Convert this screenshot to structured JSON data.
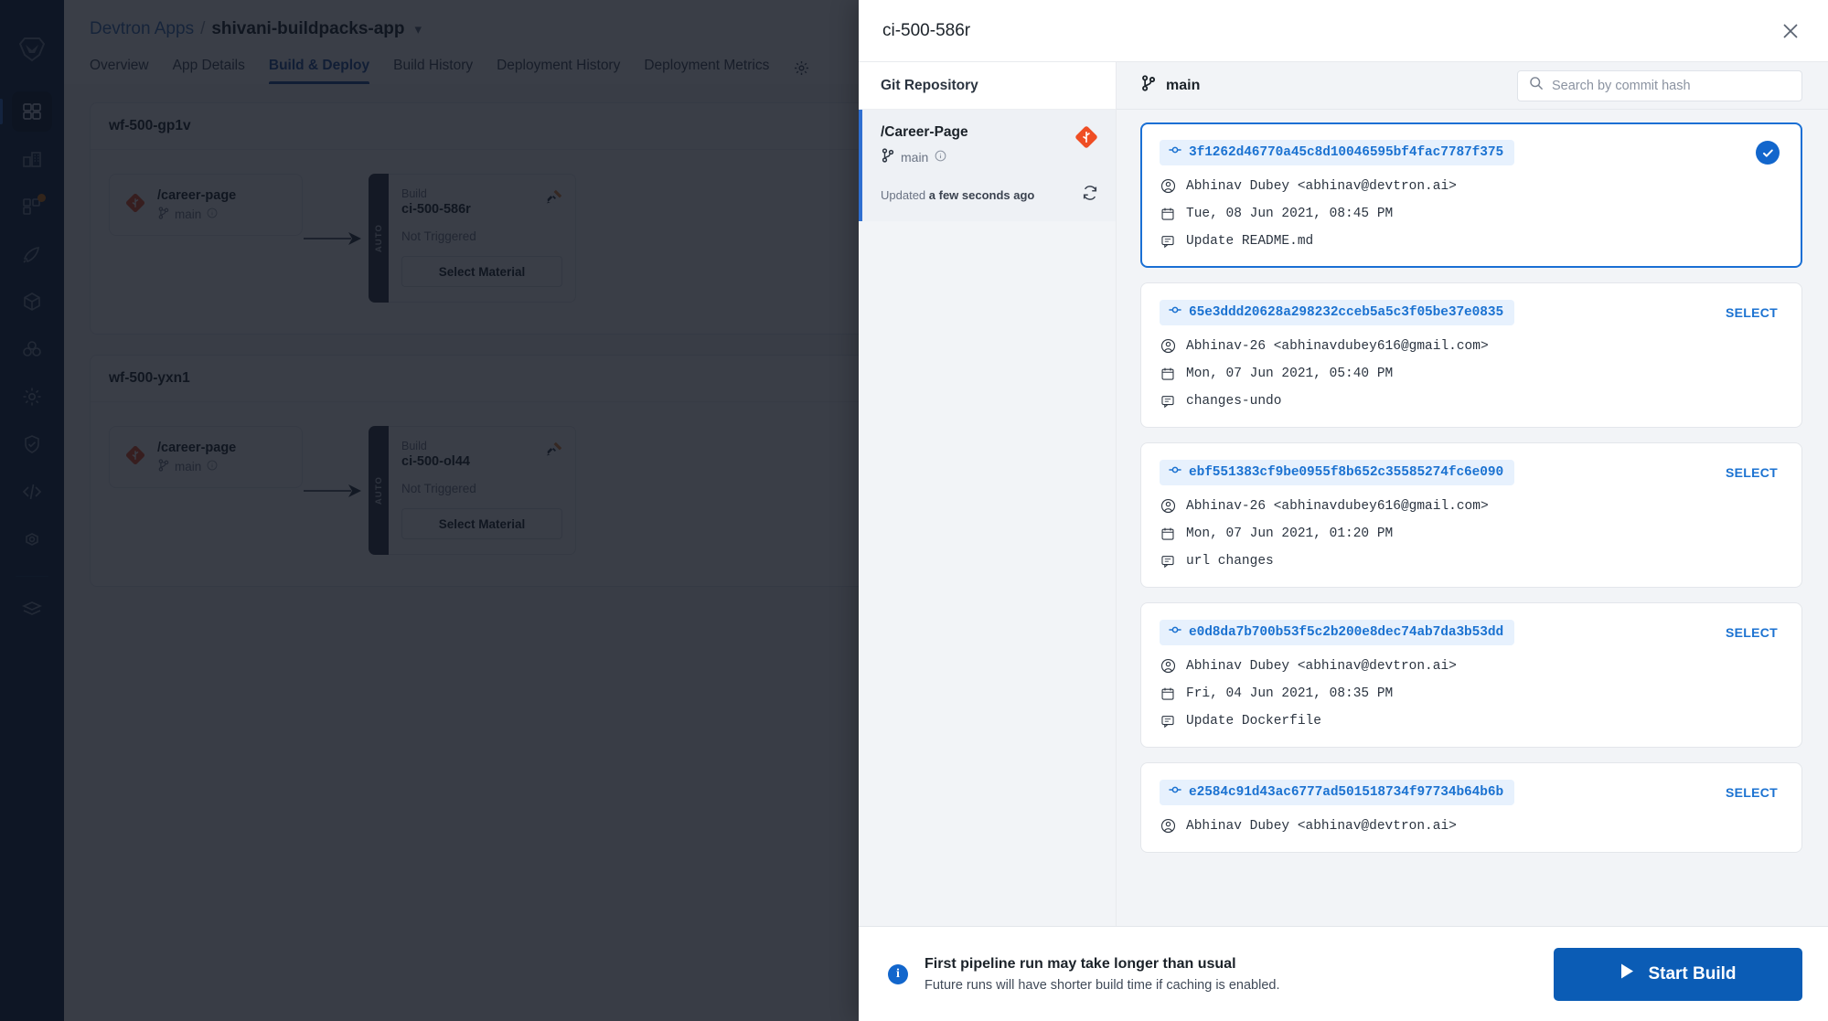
{
  "nav": {
    "logo_icon": "devtron-logo-icon",
    "items": [
      {
        "icon": "applications-icon",
        "active": true,
        "badge": false
      },
      {
        "icon": "chart-store-icon",
        "active": false,
        "badge": false
      },
      {
        "icon": "app-groups-icon",
        "active": false,
        "badge": true
      },
      {
        "icon": "rocket-deploy-icon",
        "active": false,
        "badge": false
      },
      {
        "icon": "cube-resource-icon",
        "active": false,
        "badge": false
      },
      {
        "icon": "clusters-icon",
        "active": false,
        "badge": false
      },
      {
        "icon": "gear-settings-icon",
        "active": false,
        "badge": false
      },
      {
        "icon": "shield-security-icon",
        "active": false,
        "badge": false
      },
      {
        "icon": "code-bracket-icon",
        "active": false,
        "badge": false
      },
      {
        "icon": "cog-global-config-icon",
        "active": false,
        "badge": false
      },
      {
        "icon": "stack-layers-icon",
        "active": false,
        "badge": false
      }
    ]
  },
  "breadcrumb": {
    "root": "Devtron Apps",
    "separator": "/",
    "current": "shivani-buildpacks-app",
    "caret_icon": "chevron-down-icon"
  },
  "tabs": [
    {
      "label": "Overview",
      "active": false
    },
    {
      "label": "App Details",
      "active": false
    },
    {
      "label": "Build & Deploy",
      "active": true
    },
    {
      "label": "Build History",
      "active": false
    },
    {
      "label": "Deployment History",
      "active": false
    },
    {
      "label": "Deployment Metrics",
      "active": false
    }
  ],
  "tabs_gear_icon": "gear-icon",
  "workflows": [
    {
      "name": "wf-500-gp1v",
      "git_node": {
        "repo": "/career-page",
        "branch": "main",
        "icon": "git-diamond-icon",
        "info_icon": "info-icon",
        "branch_icon": "branch-icon"
      },
      "ci_node": {
        "auto_label": "AUTO",
        "label": "Build",
        "name": "ci-500-586r",
        "status": "Not Triggered",
        "button": "Select Material",
        "tools_icon": "build-tools-icon"
      }
    },
    {
      "name": "wf-500-yxn1",
      "git_node": {
        "repo": "/career-page",
        "branch": "main",
        "icon": "git-diamond-icon",
        "info_icon": "info-icon",
        "branch_icon": "branch-icon"
      },
      "ci_node": {
        "auto_label": "AUTO",
        "label": "Build",
        "name": "ci-500-ol44",
        "status": "Not Triggered",
        "button": "Select Material",
        "tools_icon": "build-tools-icon"
      }
    }
  ],
  "modal": {
    "title": "ci-500-586r",
    "close_icon": "close-icon",
    "repo_pane": {
      "header": "Git Repository",
      "item": {
        "name": "/Career-Page",
        "branch": "main",
        "branch_icon": "branch-icon",
        "info_icon": "info-icon",
        "provider_icon": "git-diamond-icon",
        "updated_label": "Updated",
        "updated_value": "a few seconds ago",
        "refresh_icon": "refresh-icon"
      }
    },
    "commit_pane": {
      "branch_icon": "branch-icon",
      "branch": "main",
      "search": {
        "placeholder": "Search by commit hash",
        "value": "",
        "icon": "search-icon"
      },
      "select_label": "SELECT",
      "selected_icon": "check-circle-icon",
      "commits": [
        {
          "hash": "3f1262d46770a45c8d10046595bf4fac7787f375",
          "author": "Abhinav Dubey <abhinav@devtron.ai>",
          "date": "Tue, 08 Jun 2021, 08:45 PM",
          "message": "Update README.md",
          "selected": true
        },
        {
          "hash": "65e3ddd20628a298232cceb5a5c3f05be37e0835",
          "author": "Abhinav-26 <abhinavdubey616@gmail.com>",
          "date": "Mon, 07 Jun 2021, 05:40 PM",
          "message": "changes-undo",
          "selected": false
        },
        {
          "hash": "ebf551383cf9be0955f8b652c35585274fc6e090",
          "author": "Abhinav-26 <abhinavdubey616@gmail.com>",
          "date": "Mon, 07 Jun 2021, 01:20 PM",
          "message": "url changes",
          "selected": false
        },
        {
          "hash": "e0d8da7b700b53f5c2b200e8dec74ab7da3b53dd",
          "author": "Abhinav Dubey <abhinav@devtron.ai>",
          "date": "Fri, 04 Jun 2021, 08:35 PM",
          "message": "Update Dockerfile",
          "selected": false
        },
        {
          "hash": "e2584c91d43ac6777ad501518734f97734b64b6b",
          "author": "Abhinav Dubey <abhinav@devtron.ai>",
          "date": "",
          "message": "",
          "selected": false
        }
      ],
      "commit_icons": {
        "hash": "commit-icon",
        "author": "user-icon",
        "date": "calendar-icon",
        "message": "comment-icon"
      }
    },
    "footer": {
      "info_icon": "info-icon",
      "title": "First pipeline run may take longer than usual",
      "subtitle": "Future runs will have shorter build time if caching is enabled.",
      "button_label": "Start Build",
      "button_icon": "play-icon"
    }
  },
  "colors": {
    "accent_blue": "#1266cc",
    "primary_button": "#0b5cb5",
    "nav_background": "#0b2544",
    "git_orange": "#ef4e24",
    "selected_border": "#1a6fd4"
  }
}
